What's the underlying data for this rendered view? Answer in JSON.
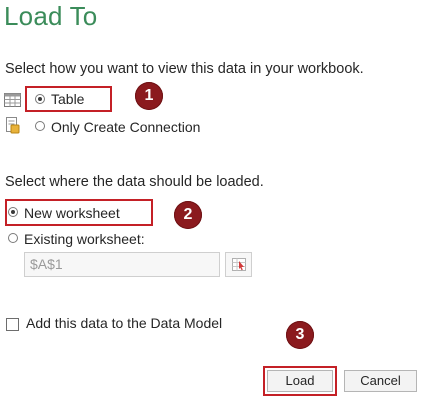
{
  "dialog": {
    "title": "Load To"
  },
  "view_section": {
    "prompt": "Select how you want to view this data in your workbook.",
    "options": [
      {
        "label": "Table",
        "selected": true,
        "icon": "table-icon"
      },
      {
        "label": "Only Create Connection",
        "selected": false,
        "icon": "connection-icon"
      }
    ]
  },
  "location_section": {
    "prompt": "Select where the data should be loaded.",
    "options": [
      {
        "label": "New worksheet",
        "selected": true
      },
      {
        "label": "Existing worksheet:",
        "selected": false
      }
    ],
    "cell_ref": {
      "value": "$A$1",
      "picker_icon": "range-picker-icon"
    }
  },
  "data_model": {
    "label": "Add this data to the Data Model",
    "checked": false
  },
  "buttons": {
    "load": "Load",
    "cancel": "Cancel"
  },
  "annotations": {
    "step1": "1",
    "step2": "2",
    "step3": "3"
  },
  "colors": {
    "title": "#3b8c5a",
    "annotation": "#c42026",
    "badge": "#8b1a1e"
  }
}
